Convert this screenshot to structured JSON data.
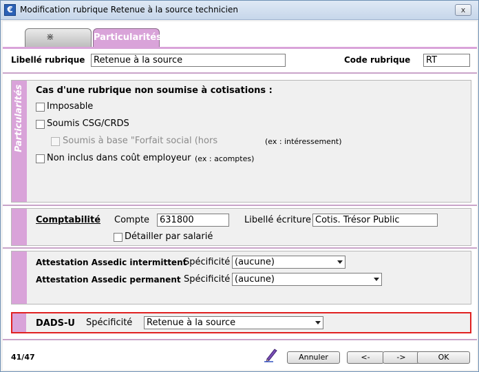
{
  "window": {
    "title": "Modification rubrique Retenue à la source technicien",
    "close_glyph": "x"
  },
  "tabs": [
    {
      "label": "",
      "icon": "tool-lines-icon"
    },
    {
      "label": "Particularités",
      "active": true
    }
  ],
  "header": {
    "libelle_label": "Libellé rubrique",
    "libelle_value": "Retenue à la source",
    "code_label": "Code rubrique",
    "code_value": "RT"
  },
  "cotisations": {
    "side_label": "Particularités",
    "title": "Cas d'une rubrique non soumise à cotisations :",
    "imposable": "Imposable",
    "csg": "Soumis CSG/CRDS",
    "forfait": "Soumis à base \"Forfait social (hors",
    "forfait_note": "(ex : intéressement)",
    "non_inclus": "Non inclus dans coût employeur",
    "non_inclus_note": "(ex : acomptes)"
  },
  "comptabilite": {
    "title": "Comptabilité",
    "compte_label": "Compte",
    "compte_value": "631800",
    "libelle_label": "Libellé écriture",
    "libelle_value": "Cotis. Trésor Public",
    "detailler": "Détailler par salarié"
  },
  "assedic": {
    "intermittent_label": "Attestation Assedic intermittent",
    "intermittent_spec": "Spécificité",
    "intermittent_value": "(aucune)",
    "permanent_label": "Attestation Assedic permanent",
    "permanent_spec": "Spécificité",
    "permanent_value": "(aucune)"
  },
  "dads": {
    "label": "DADS-U",
    "spec": "Spécificité",
    "value": "Retenue à la source"
  },
  "footer": {
    "counter": "41/47",
    "annuler": "Annuler",
    "prev": "<-",
    "next": "->",
    "ok": "OK"
  },
  "colors": {
    "accent_purple": "#d9a3d9",
    "highlight_red": "#e02020"
  }
}
